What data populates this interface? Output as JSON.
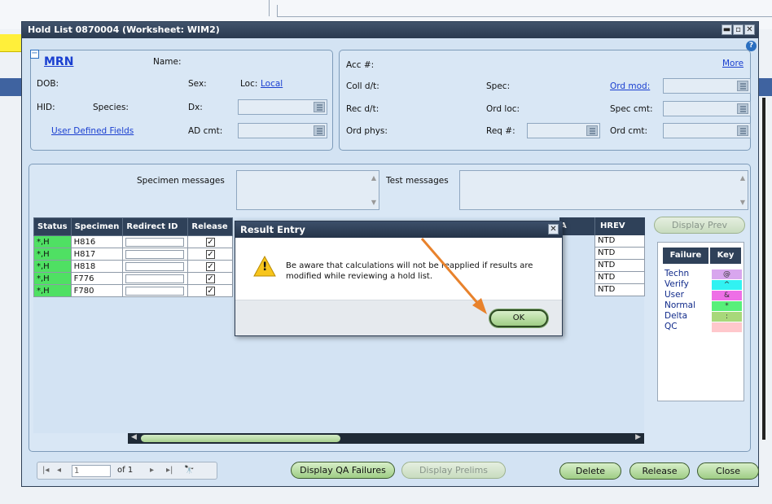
{
  "window": {
    "title": "Hold List 0870004 (Worksheet: WIM2)",
    "minimize": "▬",
    "maximize": "▫",
    "close": "✕",
    "help": "?"
  },
  "patient": {
    "mrn": "MRN",
    "collapse_glyph": "−",
    "name_label": "Name:",
    "dob_label": "DOB:",
    "sex_label": "Sex:",
    "loc_label": "Loc:",
    "loc_value": "Local",
    "hid_label": "HID:",
    "species_label": "Species:",
    "dx_label": "Dx:",
    "udf_link": "User Defined Fields",
    "ad_cmt_label": "AD cmt:"
  },
  "accession": {
    "acc_label": "Acc #:",
    "more_link": "More",
    "coll_label": "Coll d/t:",
    "spec_label": "Spec:",
    "ord_mod_label": "Ord mod:",
    "rec_label": "Rec d/t:",
    "ord_loc_label": "Ord loc:",
    "spec_cmt_label": "Spec cmt:",
    "ord_phys_label": "Ord phys:",
    "req_label": "Req #:",
    "ord_cmt_label": "Ord cmt:"
  },
  "messages": {
    "specimen_label": "Specimen messages",
    "test_label": "Test messages"
  },
  "grid": {
    "columns": [
      "Status",
      "Specimen",
      "Redirect ID",
      "Release"
    ],
    "hidden_col_fragment": "A",
    "hrev_header": "HREV",
    "check_glyph": "✓",
    "rows": [
      {
        "status": "*,H",
        "specimen": "H816",
        "hrev": "NTD"
      },
      {
        "status": "*,H",
        "specimen": "H817",
        "hrev": "NTD"
      },
      {
        "status": "*,H",
        "specimen": "H818",
        "hrev": "NTD"
      },
      {
        "status": "*,H",
        "specimen": "F776",
        "hrev": "NTD"
      },
      {
        "status": "*,H",
        "specimen": "F780",
        "hrev": "NTD"
      }
    ]
  },
  "legend": {
    "display_prev": "Display Prev",
    "failure_header": "Failure",
    "key_header": "Key",
    "rows": [
      {
        "label": "Techn",
        "key": "@",
        "color": "#d8a6ee"
      },
      {
        "label": "Verify",
        "key": "^",
        "color": "#31f2f2"
      },
      {
        "label": "User",
        "key": "&",
        "color": "#ee6fe6"
      },
      {
        "label": "Normal",
        "key": "*",
        "color": "#58f07a"
      },
      {
        "label": "Delta",
        "key": ":",
        "color": "#a8d87a"
      },
      {
        "label": "QC",
        "key": "",
        "color": "#ffc8cc"
      }
    ]
  },
  "pager": {
    "first": "|◂",
    "prev": "◂",
    "page": "1",
    "of_text": "of 1",
    "next": "▸",
    "last": "▸|",
    "find": "🔭"
  },
  "buttons": {
    "display_qa": "Display QA Failures",
    "display_prelims": "Display Prelims",
    "delete": "Delete",
    "release": "Release",
    "close": "Close"
  },
  "dialog": {
    "title": "Result Entry",
    "close": "✕",
    "warning_glyph": "!",
    "message": "Be aware that calculations will not be reapplied if results are modified while reviewing a hold list.",
    "ok": "OK"
  },
  "colors": {
    "accent": "#2f4159",
    "status_green": "#4fe063",
    "annotation_arrow": "#e8822c"
  }
}
